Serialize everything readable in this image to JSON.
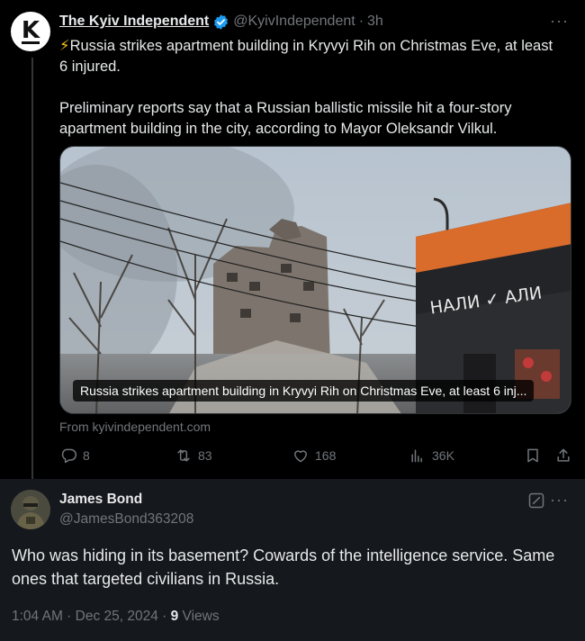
{
  "tweet": {
    "author_name": "The Kyiv Independent",
    "avatar_letter": "K",
    "handle": "@KyivIndependent",
    "separator": "·",
    "time": "3h",
    "more": "···",
    "bolt": "⚡",
    "headline": "Russia strikes apartment building in Kryvyi Rih on Christmas Eve, at least 6 injured.",
    "paragraph": "Preliminary reports say that a Russian ballistic missile hit a four-story apartment building in the city, according to Mayor Oleksandr Vilkul.",
    "media_caption": "Russia strikes apartment building in Kryvyi Rih on Christmas Eve, at least 6 inj...",
    "shop_sign": "НАЛИ ✓ АЛИ",
    "link_source": "From kyivindependent.com",
    "stats": {
      "replies": "8",
      "reposts": "83",
      "likes": "168",
      "views": "36K"
    }
  },
  "reply": {
    "author_name": "James Bond",
    "handle": "@JamesBond363208",
    "more": "···",
    "text": "Who was hiding in its basement? Cowards of the intelligence service. Same ones that targeted civilians in Russia.",
    "timestamp": "1:04 AM · Dec 25, 2024 · ",
    "views_count": "9",
    "views_label": " Views"
  },
  "colors": {
    "background": "#000000",
    "reply_background": "#15181c",
    "muted": "#71767b",
    "text": "#e7e9ea",
    "verified": "#1d9bf0"
  }
}
